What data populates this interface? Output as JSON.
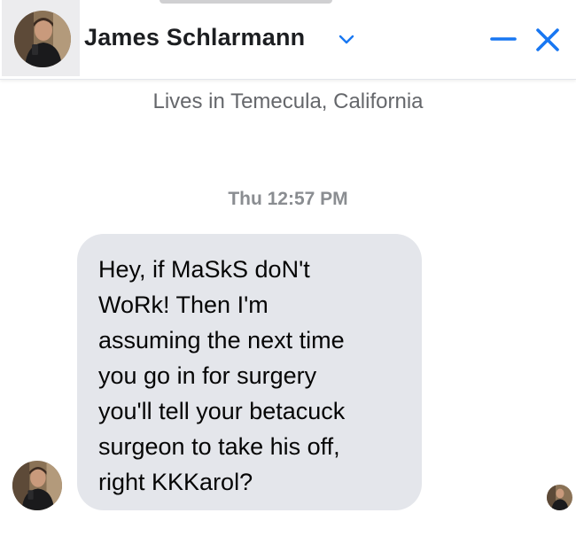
{
  "header": {
    "contact_name": "James Schlarmann",
    "chevron_icon": "chevron-down-icon",
    "minimize_icon": "minimize-icon",
    "close_icon": "close-icon",
    "accent_color": "#1877f2"
  },
  "profile": {
    "lives_in": "Lives in Temecula, California"
  },
  "thread": {
    "timestamp": "Thu 12:57 PM",
    "messages": [
      {
        "sender": "James Schlarmann",
        "text": "Hey, if MaSkS doN't\nWoRk! Then I'm\nassuming the next time\nyou go in for surgery\nyou'll tell your betacuck\nsurgeon to take his off,\nright KKKarol?"
      }
    ]
  },
  "colors": {
    "bubble_bg": "#e4e6eb",
    "secondary_text": "#65676b",
    "timestamp_text": "#8a8d91"
  }
}
